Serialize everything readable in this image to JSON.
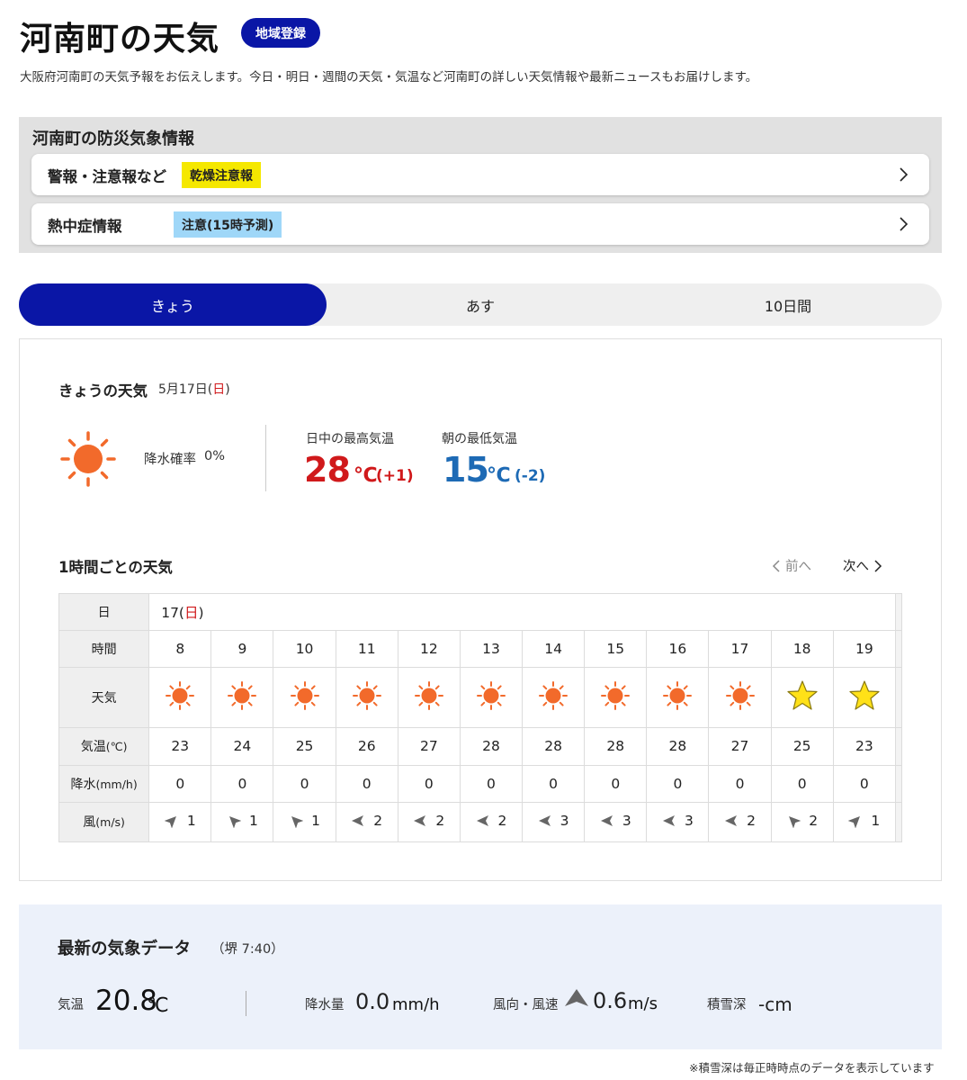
{
  "header": {
    "title": "河南町の天気",
    "register_label": "地域登録",
    "description": "大阪府河南町の天気予報をお伝えします。今日・明日・週間の天気・気温など河南町の詳しい天気情報や最新ニュースもお届けします。"
  },
  "disaster": {
    "title": "河南町の防災気象情報",
    "rows": [
      {
        "label": "警報・注意報など",
        "badge": "乾燥注意報",
        "badge_color": "#f5e800"
      },
      {
        "label": "熱中症情報",
        "badge": "注意(15時予測)",
        "badge_color": "#9fd7f8"
      }
    ]
  },
  "tabs": [
    {
      "label": "きょう",
      "active": true
    },
    {
      "label": "あす",
      "active": false
    },
    {
      "label": "10日間",
      "active": false
    }
  ],
  "today": {
    "heading": "きょうの天気",
    "date_prefix": "5月17日(",
    "date_day": "日",
    "date_suffix": ")",
    "weather_icon": "sun-icon",
    "precip_label": "降水確率",
    "precip_value": "0%",
    "high_label": "日中の最高気温",
    "high_value": "28",
    "high_unit": "℃",
    "high_diff": "(+1)",
    "low_label": "朝の最低気温",
    "low_value": "15",
    "low_unit": "℃",
    "low_diff": "(-2)"
  },
  "hourly": {
    "heading": "1時間ごとの天気",
    "prev_label": "前へ",
    "next_label": "次へ",
    "row_labels": {
      "day": "日",
      "time": "時間",
      "weather": "天気",
      "temp": "気温",
      "temp_unit": "(℃)",
      "precip": "降水",
      "precip_unit": "(mm/h)",
      "wind": "風",
      "wind_unit": "(m/s)"
    },
    "day_prefix": "17(",
    "day_name": "日",
    "day_suffix": ")",
    "hours": [
      {
        "time": "8",
        "weather": "sunny",
        "temp": "23",
        "precip": "0",
        "wind_dir": "NE",
        "wind": "1"
      },
      {
        "time": "9",
        "weather": "sunny",
        "temp": "24",
        "precip": "0",
        "wind_dir": "NW",
        "wind": "1"
      },
      {
        "time": "10",
        "weather": "sunny",
        "temp": "25",
        "precip": "0",
        "wind_dir": "NW",
        "wind": "1"
      },
      {
        "time": "11",
        "weather": "sunny",
        "temp": "26",
        "precip": "0",
        "wind_dir": "W",
        "wind": "2"
      },
      {
        "time": "12",
        "weather": "sunny",
        "temp": "27",
        "precip": "0",
        "wind_dir": "W",
        "wind": "2"
      },
      {
        "time": "13",
        "weather": "sunny",
        "temp": "28",
        "precip": "0",
        "wind_dir": "W",
        "wind": "2"
      },
      {
        "time": "14",
        "weather": "sunny",
        "temp": "28",
        "precip": "0",
        "wind_dir": "W",
        "wind": "3"
      },
      {
        "time": "15",
        "weather": "sunny",
        "temp": "28",
        "precip": "0",
        "wind_dir": "W",
        "wind": "3"
      },
      {
        "time": "16",
        "weather": "sunny",
        "temp": "28",
        "precip": "0",
        "wind_dir": "W",
        "wind": "3"
      },
      {
        "time": "17",
        "weather": "sunny",
        "temp": "27",
        "precip": "0",
        "wind_dir": "W",
        "wind": "2"
      },
      {
        "time": "18",
        "weather": "clear-night",
        "temp": "25",
        "precip": "0",
        "wind_dir": "NW",
        "wind": "2"
      },
      {
        "time": "19",
        "weather": "clear-night",
        "temp": "23",
        "precip": "0",
        "wind_dir": "NE",
        "wind": "1"
      }
    ]
  },
  "latest": {
    "title": "最新の気象データ",
    "station": "（堺 7:40）",
    "temp_label": "気温",
    "temp_value": "20.8",
    "temp_unit": "℃",
    "precip_label": "降水量",
    "precip_value": "0.0",
    "precip_unit": "mm/h",
    "wind_label": "風向・風速",
    "wind_value": "0.6",
    "wind_unit": "m/s",
    "snow_label": "積雪深",
    "snow_value": "-cm"
  },
  "footnote": "※積雪深は毎正時時点のデータを表示しています",
  "colors": {
    "accent": "#0A16A6",
    "high_temp": "#d0191b",
    "low_temp": "#1d6ab5",
    "sun": "#f26a2b",
    "star": "#ffe118"
  }
}
